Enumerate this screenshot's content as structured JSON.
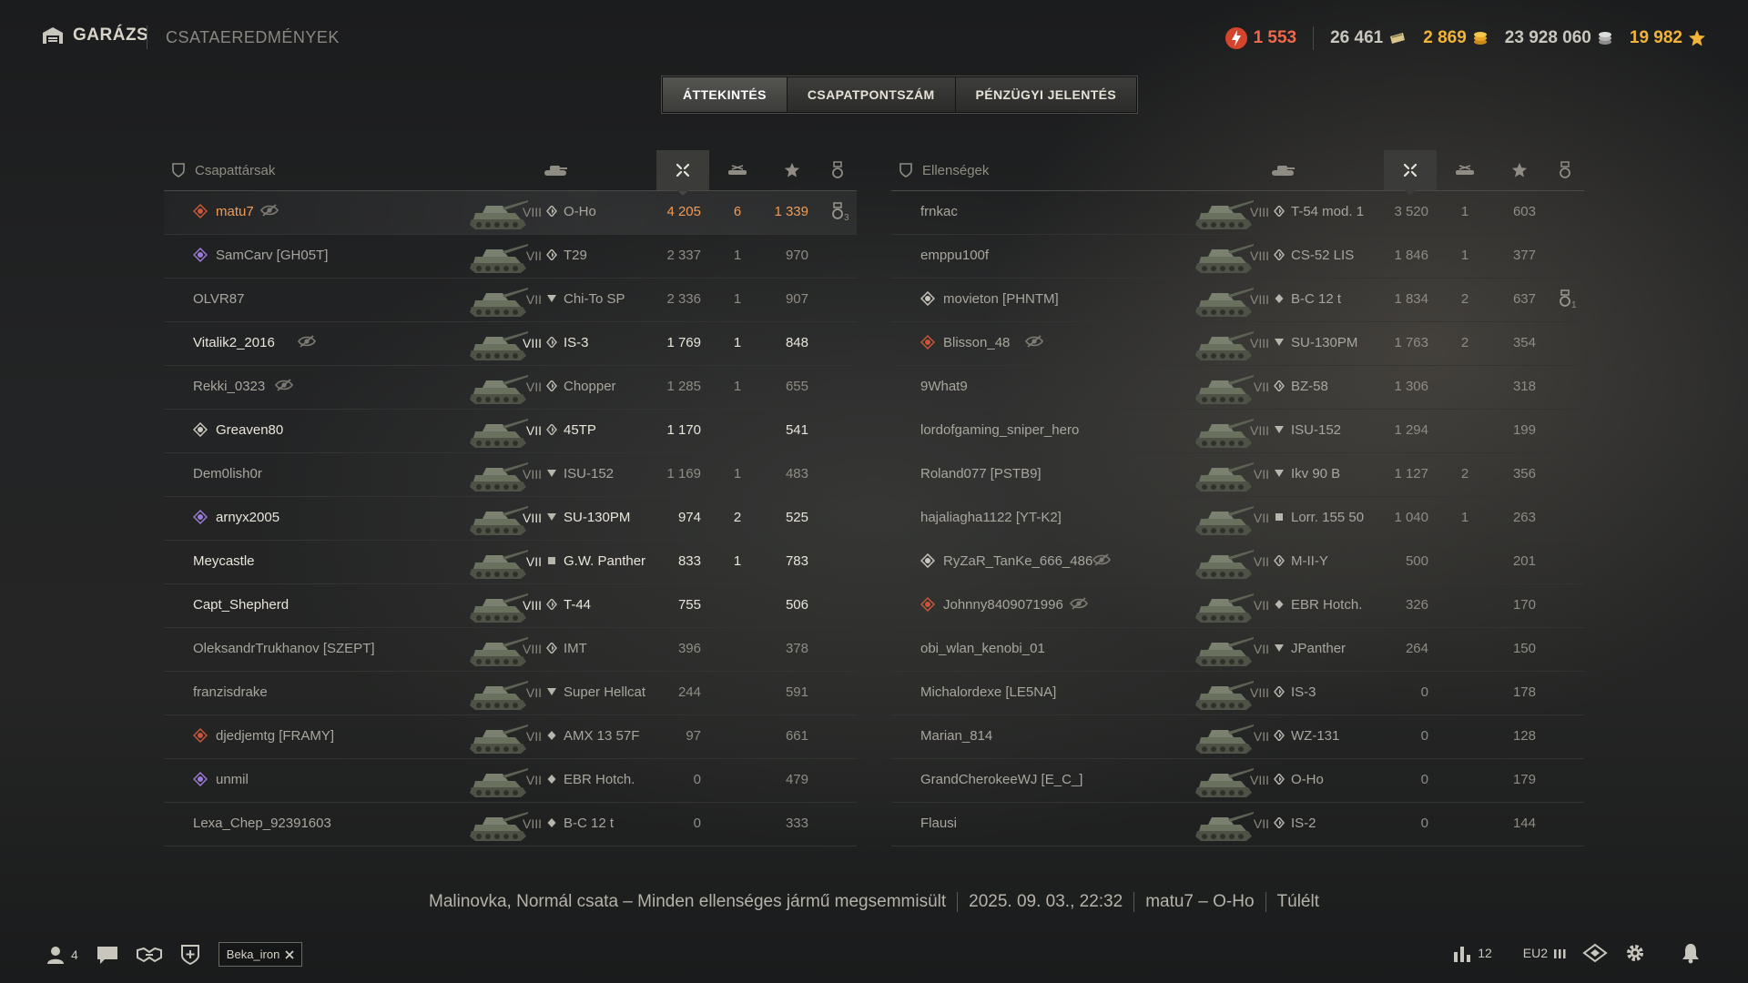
{
  "topbar": {
    "garage_label": "GARÁZS",
    "breadcrumb": "CSATAEREDMÉNYEK",
    "free_xp": "1 553",
    "bonds": "26 461",
    "gold": "2 869",
    "credits": "23 928 060",
    "experience": "19 982"
  },
  "tabs": [
    {
      "label": "ÁTTEKINTÉS",
      "active": true
    },
    {
      "label": "CSAPATPONTSZÁM",
      "active": false
    },
    {
      "label": "PÉNZÜGYI JELENTÉS",
      "active": false
    }
  ],
  "allies": {
    "title": "Csapattársak",
    "rows": [
      {
        "name": "matu7",
        "clan": true,
        "eye": true,
        "tier": "VIII",
        "cls": "medium",
        "vehicle": "O-Ho",
        "damage": "4 205",
        "kills": "6",
        "xp": "1 339",
        "medal": "3",
        "style": "me"
      },
      {
        "name": "SamCarv [GH05T]",
        "clan": true,
        "eye": false,
        "tier": "VII",
        "cls": "medium",
        "vehicle": "T29",
        "damage": "2 337",
        "kills": "1",
        "xp": "970",
        "medal": "",
        "style": "dim"
      },
      {
        "name": "OLVR87",
        "clan": false,
        "eye": false,
        "tier": "VII",
        "cls": "td",
        "vehicle": "Chi-To SP",
        "damage": "2 336",
        "kills": "1",
        "xp": "907",
        "medal": "",
        "style": "dim"
      },
      {
        "name": "Vitalik2_2016",
        "clan": false,
        "eye": true,
        "tier": "VIII",
        "cls": "medium",
        "vehicle": "IS-3",
        "damage": "1 769",
        "kills": "1",
        "xp": "848",
        "medal": "",
        "style": "bright"
      },
      {
        "name": "Rekki_0323",
        "clan": false,
        "eye": true,
        "tier": "VII",
        "cls": "medium",
        "vehicle": "Chopper",
        "damage": "1 285",
        "kills": "1",
        "xp": "655",
        "medal": "",
        "style": "dim"
      },
      {
        "name": "Greaven80",
        "clan": true,
        "eye": false,
        "tier": "VII",
        "cls": "medium",
        "vehicle": "45TP",
        "damage": "1 170",
        "kills": "",
        "xp": "541",
        "medal": "",
        "style": "bright"
      },
      {
        "name": "Dem0lish0r",
        "clan": false,
        "eye": false,
        "tier": "VIII",
        "cls": "td",
        "vehicle": "ISU-152",
        "damage": "1 169",
        "kills": "1",
        "xp": "483",
        "medal": "",
        "style": "dim"
      },
      {
        "name": "arnyx2005",
        "clan": true,
        "eye": false,
        "tier": "VIII",
        "cls": "td",
        "vehicle": "SU-130PM",
        "damage": "974",
        "kills": "2",
        "xp": "525",
        "medal": "",
        "style": "bright"
      },
      {
        "name": "Meycastle",
        "clan": false,
        "eye": false,
        "tier": "VII",
        "cls": "spg",
        "vehicle": "G.W. Panther",
        "damage": "833",
        "kills": "1",
        "xp": "783",
        "medal": "",
        "style": "bright"
      },
      {
        "name": "Capt_Shepherd",
        "clan": false,
        "eye": false,
        "tier": "VIII",
        "cls": "medium",
        "vehicle": "T-44",
        "damage": "755",
        "kills": "",
        "xp": "506",
        "medal": "",
        "style": "bright"
      },
      {
        "name": "OleksandrTrukhanov [SZEPT]",
        "clan": false,
        "eye": false,
        "tier": "VIII",
        "cls": "medium",
        "vehicle": "IMT",
        "damage": "396",
        "kills": "",
        "xp": "378",
        "medal": "",
        "style": "dim"
      },
      {
        "name": "franzisdrake",
        "clan": false,
        "eye": false,
        "tier": "VII",
        "cls": "td",
        "vehicle": "Super Hellcat",
        "damage": "244",
        "kills": "",
        "xp": "591",
        "medal": "",
        "style": "dim"
      },
      {
        "name": "djedjemtg [FRAMY]",
        "clan": true,
        "eye": false,
        "tier": "VII",
        "cls": "light",
        "vehicle": "AMX 13 57F",
        "damage": "97",
        "kills": "",
        "xp": "661",
        "medal": "",
        "style": "dim"
      },
      {
        "name": "unmil",
        "clan": true,
        "eye": false,
        "tier": "VII",
        "cls": "light",
        "vehicle": "EBR Hotch.",
        "damage": "0",
        "kills": "",
        "xp": "479",
        "medal": "",
        "style": "dim"
      },
      {
        "name": "Lexa_Chep_92391603",
        "clan": false,
        "eye": false,
        "tier": "VIII",
        "cls": "light",
        "vehicle": "B-C 12 t",
        "damage": "0",
        "kills": "",
        "xp": "333",
        "medal": "",
        "style": "dim"
      }
    ]
  },
  "enemies": {
    "title": "Ellenségek",
    "rows": [
      {
        "name": "frnkac",
        "clan": false,
        "eye": false,
        "tier": "VIII",
        "cls": "medium",
        "vehicle": "T-54 mod. 1",
        "damage": "3 520",
        "kills": "1",
        "xp": "603",
        "medal": "",
        "style": "dim"
      },
      {
        "name": "emppu100f",
        "clan": false,
        "eye": false,
        "tier": "VIII",
        "cls": "medium",
        "vehicle": "CS-52 LIS",
        "damage": "1 846",
        "kills": "1",
        "xp": "377",
        "medal": "",
        "style": "dim"
      },
      {
        "name": "movieton [PHNTM]",
        "clan": true,
        "eye": false,
        "tier": "VIII",
        "cls": "light",
        "vehicle": "B-C 12 t",
        "damage": "1 834",
        "kills": "2",
        "xp": "637",
        "medal": "1",
        "style": "dim"
      },
      {
        "name": "Blisson_48",
        "clan": true,
        "eye": true,
        "tier": "VIII",
        "cls": "td",
        "vehicle": "SU-130PM",
        "damage": "1 763",
        "kills": "2",
        "xp": "354",
        "medal": "",
        "style": "dim"
      },
      {
        "name": "9What9",
        "clan": false,
        "eye": false,
        "tier": "VII",
        "cls": "medium",
        "vehicle": "BZ-58",
        "damage": "1 306",
        "kills": "",
        "xp": "318",
        "medal": "",
        "style": "dim"
      },
      {
        "name": "lordofgaming_sniper_hero",
        "clan": false,
        "eye": false,
        "tier": "VIII",
        "cls": "td",
        "vehicle": "ISU-152",
        "damage": "1 294",
        "kills": "",
        "xp": "199",
        "medal": "",
        "style": "dim"
      },
      {
        "name": "Roland077 [PSTB9]",
        "clan": false,
        "eye": false,
        "tier": "VII",
        "cls": "td",
        "vehicle": "Ikv 90 B",
        "damage": "1 127",
        "kills": "2",
        "xp": "356",
        "medal": "",
        "style": "dim"
      },
      {
        "name": "hajaliagha1122 [YT-K2]",
        "clan": false,
        "eye": false,
        "tier": "VII",
        "cls": "spg",
        "vehicle": "Lorr. 155 50",
        "damage": "1 040",
        "kills": "1",
        "xp": "263",
        "medal": "",
        "style": "dim"
      },
      {
        "name": "RyZaR_TanKe_666_486",
        "clan": true,
        "eye": true,
        "tier": "VII",
        "cls": "medium",
        "vehicle": "M-II-Y",
        "damage": "500",
        "kills": "",
        "xp": "201",
        "medal": "",
        "style": "dim"
      },
      {
        "name": "Johnny8409071996",
        "clan": true,
        "eye": true,
        "tier": "VII",
        "cls": "light",
        "vehicle": "EBR Hotch.",
        "damage": "326",
        "kills": "",
        "xp": "170",
        "medal": "",
        "style": "dim"
      },
      {
        "name": "obi_wlan_kenobi_01",
        "clan": false,
        "eye": false,
        "tier": "VII",
        "cls": "td",
        "vehicle": "JPanther",
        "damage": "264",
        "kills": "",
        "xp": "150",
        "medal": "",
        "style": "dim"
      },
      {
        "name": "Michalordexe [LE5NA]",
        "clan": false,
        "eye": false,
        "tier": "VIII",
        "cls": "medium",
        "vehicle": "IS-3",
        "damage": "0",
        "kills": "",
        "xp": "178",
        "medal": "",
        "style": "dim"
      },
      {
        "name": "Marian_814",
        "clan": false,
        "eye": false,
        "tier": "VII",
        "cls": "medium",
        "vehicle": "WZ-131",
        "damage": "0",
        "kills": "",
        "xp": "128",
        "medal": "",
        "style": "dim"
      },
      {
        "name": "GrandCherokeeWJ [E_C_]",
        "clan": false,
        "eye": false,
        "tier": "VIII",
        "cls": "medium",
        "vehicle": "O-Ho",
        "damage": "0",
        "kills": "",
        "xp": "179",
        "medal": "",
        "style": "dim"
      },
      {
        "name": "Flausi",
        "clan": false,
        "eye": false,
        "tier": "VII",
        "cls": "medium",
        "vehicle": "IS-2",
        "damage": "0",
        "kills": "",
        "xp": "144",
        "medal": "",
        "style": "dim"
      }
    ]
  },
  "battle_info": {
    "map_mode": "Malinovka, Normál csata – Minden ellenséges jármű megsemmisült",
    "datetime": "2025. 09. 03., 22:32",
    "player_vehicle": "matu7 – O-Ho",
    "status": "Túlélt"
  },
  "bottombar": {
    "friends_count": "4",
    "chip_label": "Beka_iron",
    "stats_value": "12",
    "server": "EU2"
  },
  "colors": {
    "accent_orange": "#f19b56",
    "gold": "#f1b43b",
    "free_xp_red": "#ef6a4d"
  }
}
